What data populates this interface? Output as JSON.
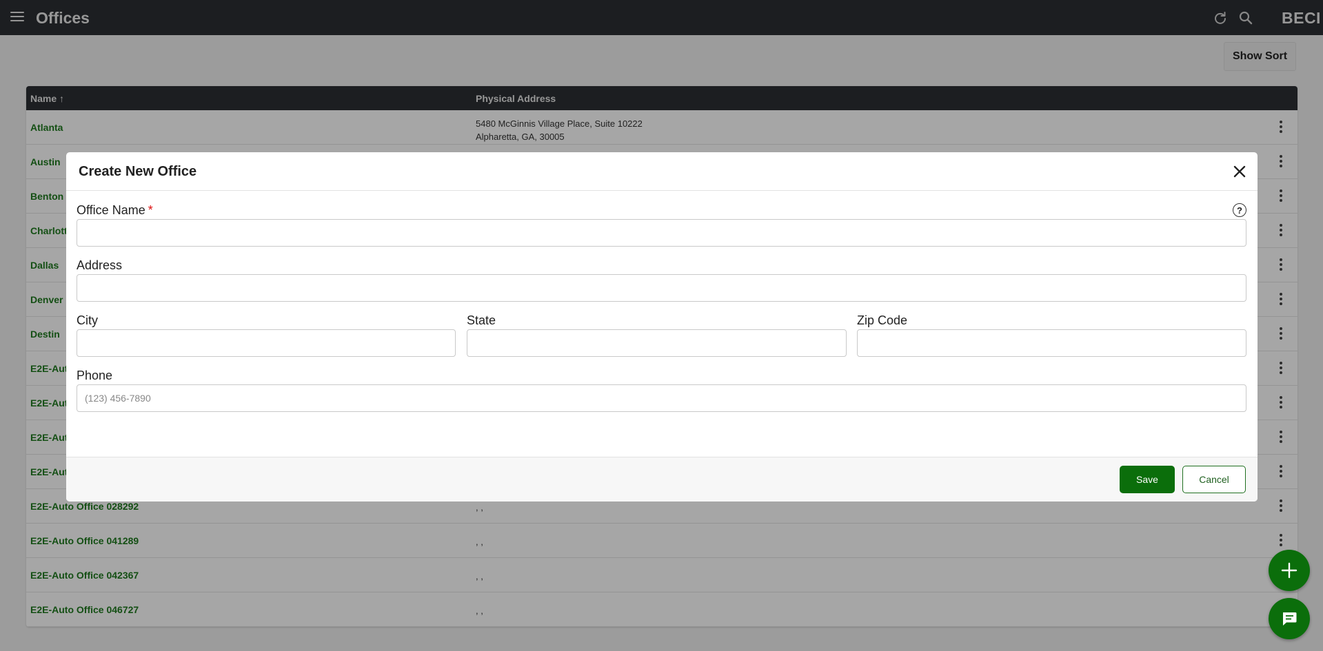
{
  "topbar": {
    "title": "Offices",
    "brand": "BECI",
    "icons": [
      "menu-icon",
      "refresh-icon",
      "search-icon"
    ]
  },
  "toolbar": {
    "show_sort_label": "Show Sort"
  },
  "table": {
    "columns": [
      {
        "label": "Name ↑"
      },
      {
        "label": "Physical Address"
      }
    ],
    "rows": [
      {
        "name": "Atlanta",
        "address_line1": "5480 McGinnis Village Place, Suite 10222",
        "address_line2": "Alpharetta, GA, 30005"
      },
      {
        "name": "Austin",
        "address_line1": "",
        "address_line2": ""
      },
      {
        "name": "Benton (",
        "address_line1": "",
        "address_line2": ""
      },
      {
        "name": "Charlott",
        "address_line1": "",
        "address_line2": ""
      },
      {
        "name": "Dallas",
        "address_line1": "",
        "address_line2": ""
      },
      {
        "name": "Denver",
        "address_line1": "",
        "address_line2": ""
      },
      {
        "name": "Destin",
        "address_line1": "",
        "address_line2": ""
      },
      {
        "name": "E2E-Auto",
        "address_line1": "",
        "address_line2": ""
      },
      {
        "name": "E2E-Auto",
        "address_line1": "",
        "address_line2": ""
      },
      {
        "name": "E2E-Auto",
        "address_line1": "",
        "address_line2": ""
      },
      {
        "name": "E2E-Auto",
        "address_line1": "",
        "address_line2": ""
      },
      {
        "name": "E2E-Auto Office 028292",
        "address_line1": ", ,",
        "address_line2": ""
      },
      {
        "name": "E2E-Auto Office 041289",
        "address_line1": ", ,",
        "address_line2": ""
      },
      {
        "name": "E2E-Auto Office 042367",
        "address_line1": ", ,",
        "address_line2": ""
      },
      {
        "name": "E2E-Auto Office 046727",
        "address_line1": ", ,",
        "address_line2": ""
      }
    ]
  },
  "modal": {
    "title": "Create New Office",
    "office_name_label": "Office Name",
    "required_mark": "*",
    "help_glyph": "?",
    "address_label": "Address",
    "city_label": "City",
    "state_label": "State",
    "zip_label": "Zip Code",
    "phone_label": "Phone",
    "phone_placeholder": "(123) 456-7890",
    "office_name_value": "",
    "address_value": "",
    "city_value": "",
    "state_value": "",
    "zip_value": "",
    "phone_value": "",
    "save_label": "Save",
    "cancel_label": "Cancel"
  },
  "colors": {
    "accent": "#0b6e0b",
    "link": "#1f7a1f",
    "topbar": "#2b2f33",
    "required": "#dd1111"
  }
}
